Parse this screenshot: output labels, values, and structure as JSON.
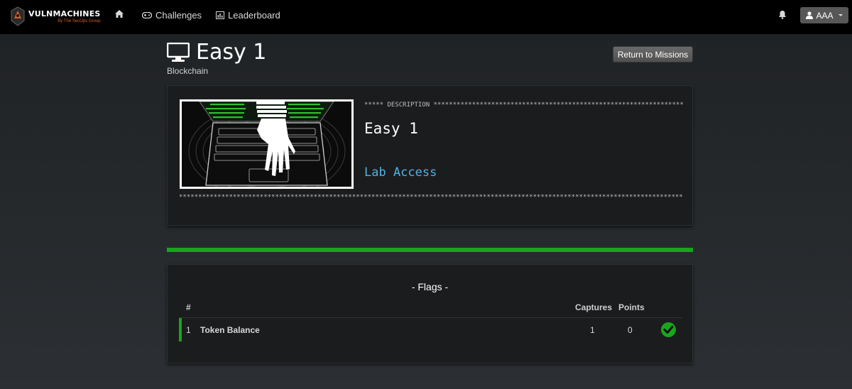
{
  "nav": {
    "brand_name": "VULNMACHINES",
    "brand_sub": "By The SecOps Group",
    "home_icon": "home-icon",
    "challenges_label": "Challenges",
    "leaderboard_label": "Leaderboard",
    "bell_icon": "bell-icon",
    "user_label": "AAA"
  },
  "header": {
    "title": "Easy 1",
    "category": "Blockchain",
    "return_label": "Return to Missions"
  },
  "description": {
    "stars_line": "***** DESCRIPTION ****************************************************************************",
    "title": "Easy 1",
    "lab_access": "Lab Access",
    "bottom_stars": "**********************************************************************************************************************************************************************"
  },
  "progress": {
    "completed": 1,
    "total": 1
  },
  "flags": {
    "title": "- Flags -",
    "columns": {
      "num": "#",
      "captures": "Captures",
      "points": "Points"
    },
    "rows": [
      {
        "num": "1",
        "name": "Token Balance",
        "captures": "1",
        "points": "0",
        "status": "solved"
      }
    ]
  },
  "colors": {
    "accent_green": "#19a51c",
    "link_blue": "#4fb3e6",
    "brand_orange": "#e05a2b"
  }
}
